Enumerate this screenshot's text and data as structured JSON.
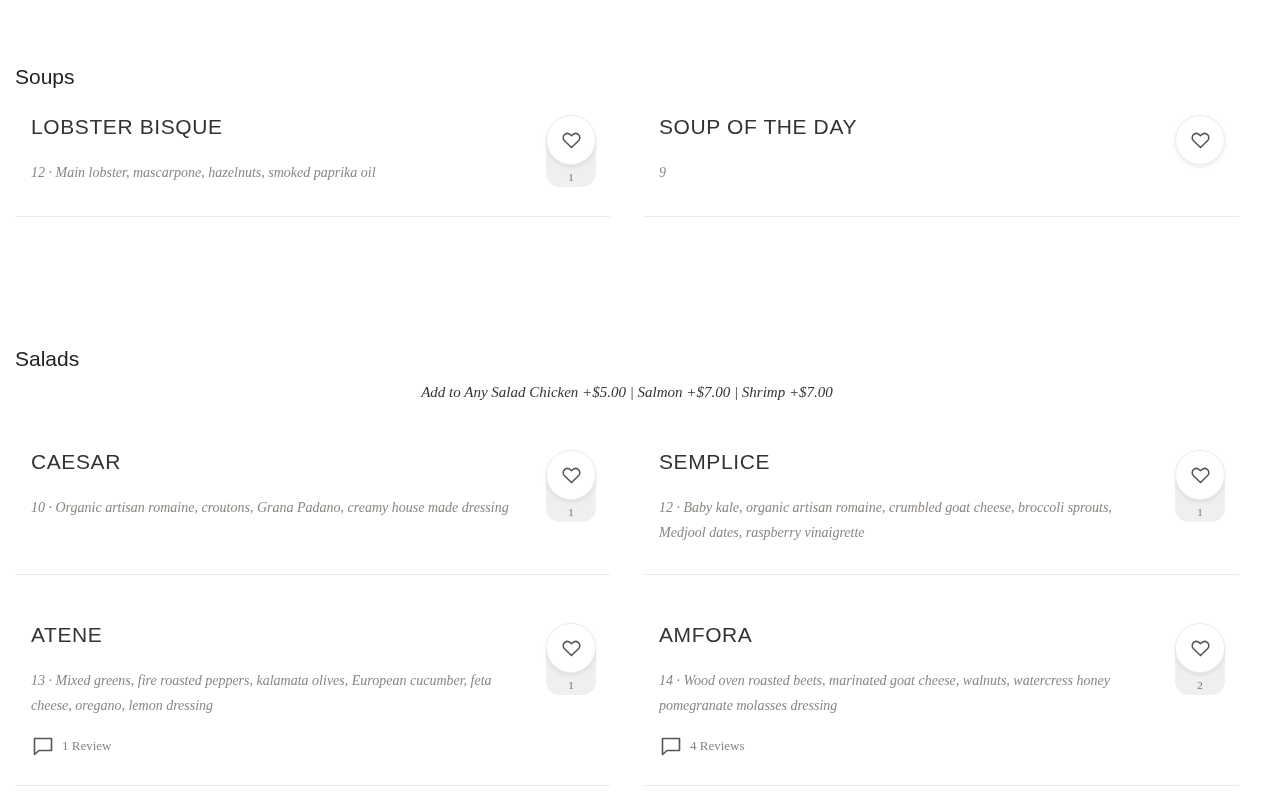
{
  "sections": [
    {
      "title": "Soups",
      "items": [
        {
          "name": "LOBSTER BISQUE",
          "description": "12 · Main lobster, mascarpone, hazelnuts, smoked paprika oil",
          "likes": "1"
        },
        {
          "name": "SOUP OF THE DAY",
          "description": "9"
        }
      ]
    },
    {
      "title": "Salads",
      "note": "Add to Any Salad Chicken +$5.00 | Salmon +$7.00 | Shrimp +$7.00",
      "items": [
        {
          "name": "CAESAR",
          "description": "10 · Organic artisan romaine, croutons, Grana Padano, creamy house made dressing",
          "likes": "1"
        },
        {
          "name": "SEMPLICE",
          "description": "12 · Baby kale, organic artisan romaine, crumbled goat cheese, broccoli sprouts, Medjool dates, raspberry vinaigrette",
          "likes": "1"
        },
        {
          "name": "ATENE",
          "description": "13 · Mixed greens, fire roasted peppers, kalamata olives, European cucumber, feta cheese, oregano, lemon dressing",
          "likes": "1",
          "reviews": "1 Review"
        },
        {
          "name": "AMFORA",
          "description": "14 · Wood oven roasted beets, marinated goat cheese, walnuts, watercress honey pomegranate molasses dressing",
          "likes": "2",
          "reviews": "4 Reviews"
        }
      ]
    }
  ]
}
